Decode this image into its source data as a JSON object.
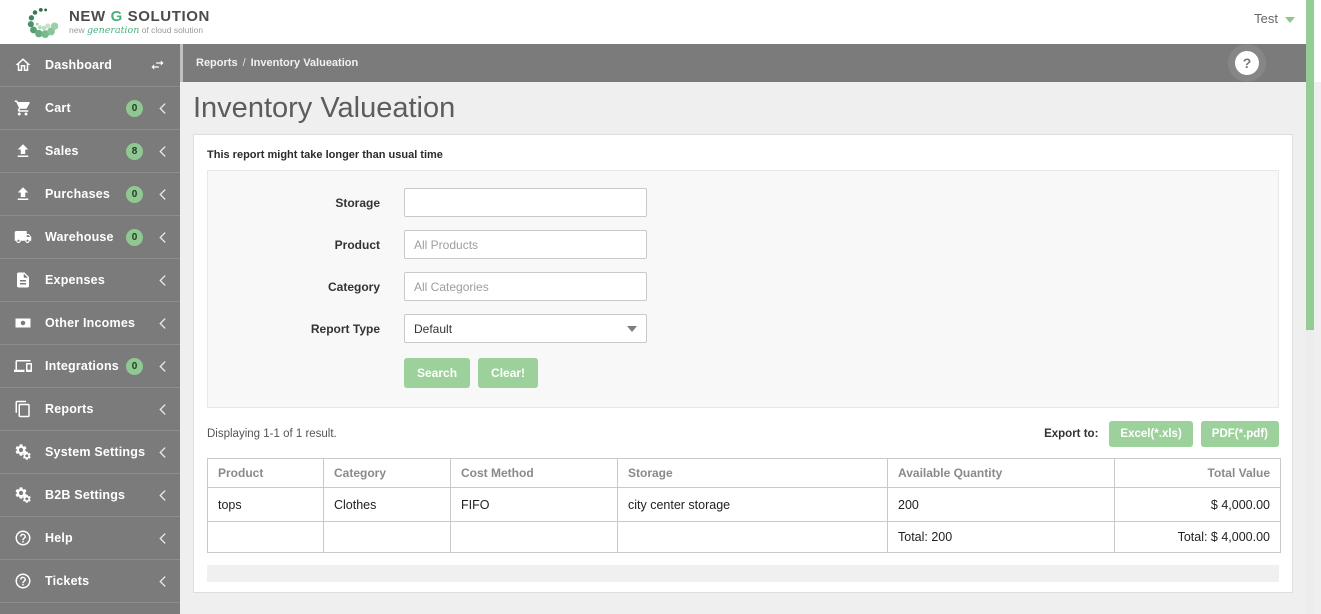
{
  "header": {
    "brand": {
      "name_1": "NEW",
      "name_2": "G",
      "name_3": "SOLUTION",
      "tagline_1": "new",
      "tagline_2": "generation",
      "tagline_3": "of cloud solution"
    },
    "user_menu": "Test"
  },
  "sidebar": {
    "items": [
      {
        "label": "Dashboard",
        "icon": "home-icon",
        "badge": null,
        "trailing": "swap-arrows-icon"
      },
      {
        "label": "Cart",
        "icon": "cart-icon",
        "badge": "0",
        "trailing": "chevron-left-icon"
      },
      {
        "label": "Sales",
        "icon": "upload-icon",
        "badge": "8",
        "trailing": "chevron-left-icon"
      },
      {
        "label": "Purchases",
        "icon": "upload-icon",
        "badge": "0",
        "trailing": "chevron-left-icon"
      },
      {
        "label": "Warehouse",
        "icon": "truck-icon",
        "badge": "0",
        "trailing": "chevron-left-icon"
      },
      {
        "label": "Expenses",
        "icon": "invoice-icon",
        "badge": null,
        "trailing": "chevron-left-icon"
      },
      {
        "label": "Other Incomes",
        "icon": "money-icon",
        "badge": null,
        "trailing": "chevron-left-icon"
      },
      {
        "label": "Integrations",
        "icon": "devices-icon",
        "badge": "0",
        "trailing": "chevron-left-icon"
      },
      {
        "label": "Reports",
        "icon": "pages-icon",
        "badge": null,
        "trailing": "chevron-left-icon"
      },
      {
        "label": "System Settings",
        "icon": "gears-icon",
        "badge": null,
        "trailing": "chevron-left-icon"
      },
      {
        "label": "B2B Settings",
        "icon": "gears-icon",
        "badge": null,
        "trailing": "chevron-left-icon"
      },
      {
        "label": "Help",
        "icon": "question-icon",
        "badge": null,
        "trailing": "chevron-left-icon"
      },
      {
        "label": "Tickets",
        "icon": "question-icon",
        "badge": null,
        "trailing": "chevron-left-icon"
      }
    ]
  },
  "breadcrumb": {
    "section": "Reports",
    "separator": "/",
    "page": "Inventory Valueation",
    "help_icon": "question-icon"
  },
  "page": {
    "title": "Inventory Valueation",
    "notice": "This report might take longer than usual time"
  },
  "form": {
    "fields": [
      {
        "label": "Storage",
        "type": "text",
        "value": "",
        "placeholder": ""
      },
      {
        "label": "Product",
        "type": "text",
        "value": "",
        "placeholder": "All Products"
      },
      {
        "label": "Category",
        "type": "text",
        "value": "",
        "placeholder": "All Categories"
      },
      {
        "label": "Report Type",
        "type": "select",
        "value": "Default"
      }
    ],
    "search_label": "Search",
    "clear_label": "Clear!"
  },
  "results": {
    "summary": "Displaying 1-1 of 1 result.",
    "export_label": "Export to:",
    "export_buttons": [
      {
        "label": "Excel(*.xls)"
      },
      {
        "label": "PDF(*.pdf)"
      }
    ]
  },
  "table": {
    "columns": [
      "Product",
      "Category",
      "Cost Method",
      "Storage",
      "Available Quantity",
      "Total Value"
    ],
    "rows": [
      [
        "tops",
        "Clothes",
        "FIFO",
        "city center storage",
        "200",
        "$ 4,000.00"
      ]
    ],
    "footer": [
      "",
      "",
      "",
      "",
      "Total: 200",
      "Total: $ 4,000.00"
    ]
  },
  "colors": {
    "accent_green": "#9cd19c",
    "badge_green": "#8fc893",
    "scrollbar_green": "#95cb95",
    "sidebar_gray": "#7b7b7b",
    "brand_green": "#4caf7d"
  }
}
